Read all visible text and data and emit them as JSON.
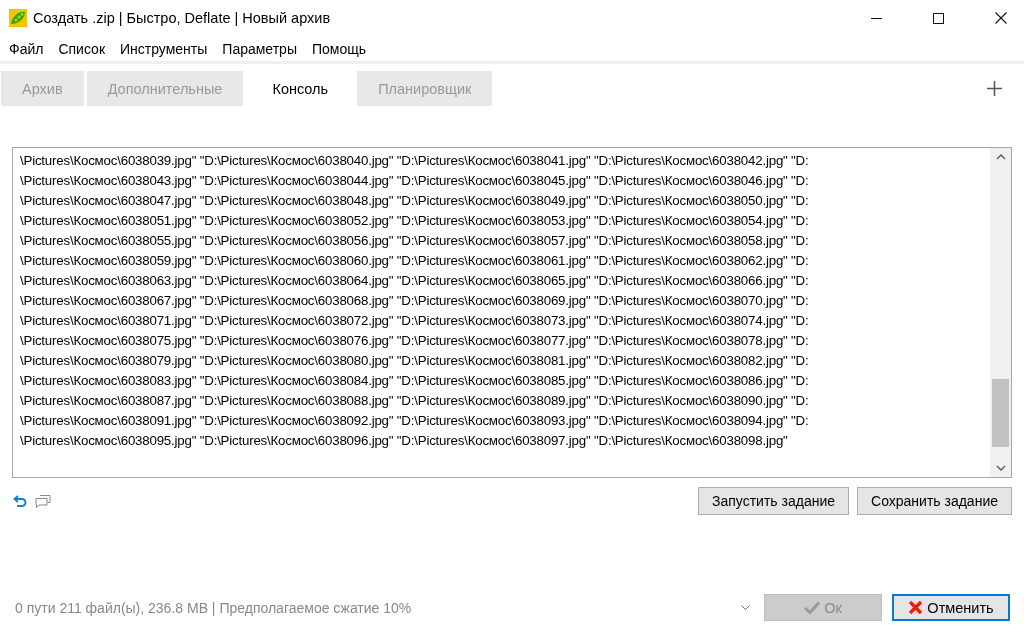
{
  "window": {
    "title": "Создать .zip | Быстро, Deflate | Новый архив"
  },
  "menu": [
    "Файл",
    "Список",
    "Инструменты",
    "Параметры",
    "Помощь"
  ],
  "tabs": [
    {
      "label": "Архив",
      "selected": false
    },
    {
      "label": "Дополнительные",
      "selected": false
    },
    {
      "label": "Консоль",
      "selected": true
    },
    {
      "label": "Планировщик",
      "selected": false
    }
  ],
  "console": {
    "lines": [
      "\\Pictures\\Космос\\6038039.jpg\" \"D:\\Pictures\\Космос\\6038040.jpg\" \"D:\\Pictures\\Космос\\6038041.jpg\" \"D:\\Pictures\\Космос\\6038042.jpg\" \"D:",
      "\\Pictures\\Космос\\6038043.jpg\" \"D:\\Pictures\\Космос\\6038044.jpg\" \"D:\\Pictures\\Космос\\6038045.jpg\" \"D:\\Pictures\\Космос\\6038046.jpg\" \"D:",
      "\\Pictures\\Космос\\6038047.jpg\" \"D:\\Pictures\\Космос\\6038048.jpg\" \"D:\\Pictures\\Космос\\6038049.jpg\" \"D:\\Pictures\\Космос\\6038050.jpg\" \"D:",
      "\\Pictures\\Космос\\6038051.jpg\" \"D:\\Pictures\\Космос\\6038052.jpg\" \"D:\\Pictures\\Космос\\6038053.jpg\" \"D:\\Pictures\\Космос\\6038054.jpg\" \"D:",
      "\\Pictures\\Космос\\6038055.jpg\" \"D:\\Pictures\\Космос\\6038056.jpg\" \"D:\\Pictures\\Космос\\6038057.jpg\" \"D:\\Pictures\\Космос\\6038058.jpg\" \"D:",
      "\\Pictures\\Космос\\6038059.jpg\" \"D:\\Pictures\\Космос\\6038060.jpg\" \"D:\\Pictures\\Космос\\6038061.jpg\" \"D:\\Pictures\\Космос\\6038062.jpg\" \"D:",
      "\\Pictures\\Космос\\6038063.jpg\" \"D:\\Pictures\\Космос\\6038064.jpg\" \"D:\\Pictures\\Космос\\6038065.jpg\" \"D:\\Pictures\\Космос\\6038066.jpg\" \"D:",
      "\\Pictures\\Космос\\6038067.jpg\" \"D:\\Pictures\\Космос\\6038068.jpg\" \"D:\\Pictures\\Космос\\6038069.jpg\" \"D:\\Pictures\\Космос\\6038070.jpg\" \"D:",
      "\\Pictures\\Космос\\6038071.jpg\" \"D:\\Pictures\\Космос\\6038072.jpg\" \"D:\\Pictures\\Космос\\6038073.jpg\" \"D:\\Pictures\\Космос\\6038074.jpg\" \"D:",
      "\\Pictures\\Космос\\6038075.jpg\" \"D:\\Pictures\\Космос\\6038076.jpg\" \"D:\\Pictures\\Космос\\6038077.jpg\" \"D:\\Pictures\\Космос\\6038078.jpg\" \"D:",
      "\\Pictures\\Космос\\6038079.jpg\" \"D:\\Pictures\\Космос\\6038080.jpg\" \"D:\\Pictures\\Космос\\6038081.jpg\" \"D:\\Pictures\\Космос\\6038082.jpg\" \"D:",
      "\\Pictures\\Космос\\6038083.jpg\" \"D:\\Pictures\\Космос\\6038084.jpg\" \"D:\\Pictures\\Космос\\6038085.jpg\" \"D:\\Pictures\\Космос\\6038086.jpg\" \"D:",
      "\\Pictures\\Космос\\6038087.jpg\" \"D:\\Pictures\\Космос\\6038088.jpg\" \"D:\\Pictures\\Космос\\6038089.jpg\" \"D:\\Pictures\\Космос\\6038090.jpg\" \"D:",
      "\\Pictures\\Космос\\6038091.jpg\" \"D:\\Pictures\\Космос\\6038092.jpg\" \"D:\\Pictures\\Космос\\6038093.jpg\" \"D:\\Pictures\\Космос\\6038094.jpg\" \"D:",
      "\\Pictures\\Космос\\6038095.jpg\" \"D:\\Pictures\\Космос\\6038096.jpg\" \"D:\\Pictures\\Космос\\6038097.jpg\" \"D:\\Pictures\\Космос\\6038098.jpg\""
    ]
  },
  "task_buttons": [
    "Запустить задание",
    "Сохранить задание"
  ],
  "status_bar": "0 пути 211 файл(ы), 236.8 MB | Предполагаемое сжатие 10%",
  "ok_button": {
    "label": "Ок",
    "disabled": true
  },
  "cancel_button": {
    "label": "Отменить",
    "focused": true
  }
}
